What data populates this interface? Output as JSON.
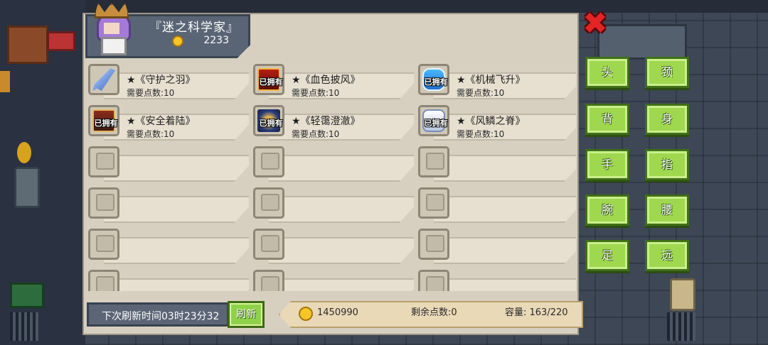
{
  "shop": {
    "title": "『迷之科学家』",
    "gold": "2233"
  },
  "items": [
    {
      "name": "★《守护之羽》",
      "cost": "需要点数:10",
      "owned": "",
      "icon": "blue-feather-icon"
    },
    {
      "name": "★《血色披风》",
      "cost": "需要点数:10",
      "owned": "已拥有",
      "icon": "red-cape-icon"
    },
    {
      "name": "★《机械飞升》",
      "cost": "需要点数:10",
      "owned": "已拥有",
      "icon": "mech-wing-icon"
    },
    {
      "name": "★《安全着陆》",
      "cost": "需要点数:10",
      "owned": "已拥有",
      "icon": "landing-gear-icon"
    },
    {
      "name": "★《轻霭澄澈》",
      "cost": "需要点数:10",
      "owned": "已拥有",
      "icon": "clear-mist-icon"
    },
    {
      "name": "★《风鳞之脊》",
      "cost": "需要点数:10",
      "owned": "已拥有",
      "icon": "wind-scale-icon"
    }
  ],
  "footer": {
    "refresh_timer": "下次刷新时间03时23分32",
    "refresh_label": "刷新",
    "gold_total": "1450990",
    "remaining_points": "剩余点数:0",
    "capacity": "容量: 163/220"
  },
  "categories": {
    "head": "头",
    "neck": "颈",
    "back": "背",
    "body": "身",
    "hand": "手",
    "finger": "指",
    "wrist": "腕",
    "waist": "腰",
    "foot": "足",
    "ranged": "远"
  },
  "close_icon": "close-icon",
  "colors": {
    "panel": "#d7d0c0",
    "category_green": "#9fd84f",
    "close_red": "#e32424",
    "coin": "#f5c626"
  }
}
